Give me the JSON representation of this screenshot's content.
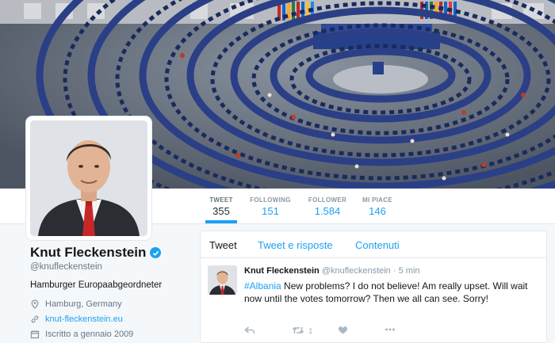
{
  "profile": {
    "name": "Knut Fleckenstein",
    "handle": "@knufleckenstein",
    "bio": "Hamburger Europaabgeordneter",
    "location": "Hamburg, Germany",
    "website": "knut-fleckenstein.eu",
    "joined": "Iscritto a gennaio 2009"
  },
  "stats": [
    {
      "label": "TWEET",
      "value": "355"
    },
    {
      "label": "FOLLOWING",
      "value": "151"
    },
    {
      "label": "FOLLOWER",
      "value": "1.584"
    },
    {
      "label": "MI PIACE",
      "value": "146"
    }
  ],
  "timeline_tabs": [
    "Tweet",
    "Tweet e risposte",
    "Contenuti"
  ],
  "tweet": {
    "author": "Knut Fleckenstein",
    "handle": "@knufleckenstein",
    "separator": "·",
    "time": "5 min",
    "hashtag": "#Albania",
    "text": " New problems? I do not believe! Am really upset. Will wait now until the votes tomorrow? Then we all can see. Sorry!",
    "retweet_count": "1"
  },
  "icons": {
    "verified": "verified-badge-icon",
    "location": "location-pin-icon",
    "link": "link-icon",
    "calendar": "calendar-icon",
    "reply": "reply-icon",
    "retweet": "retweet-icon",
    "like": "heart-icon",
    "more": "more-icon"
  },
  "colors": {
    "accent": "#1da1f2",
    "text_primary": "#14171a",
    "text_secondary": "#657786",
    "background": "#f5f8fa"
  }
}
